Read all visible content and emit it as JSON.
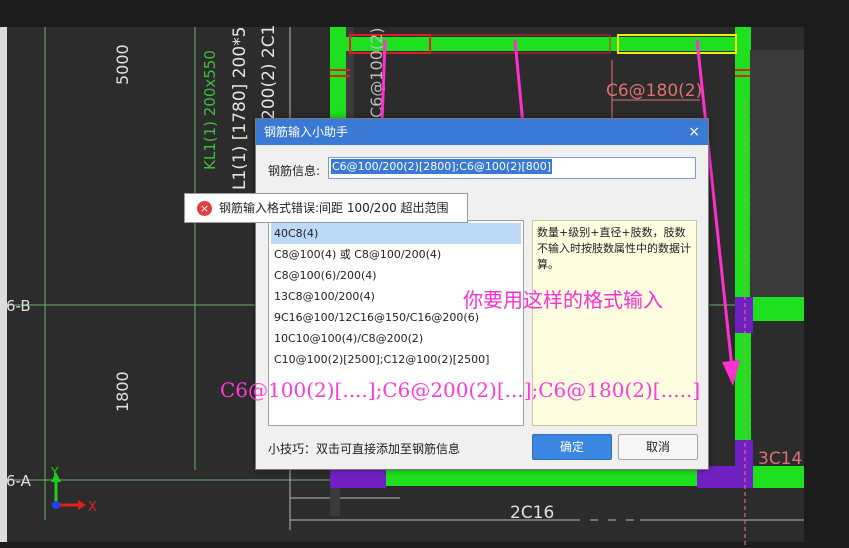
{
  "cad": {
    "dim_5000": "5000",
    "dim_1800": "1800",
    "axis_6b": "6-B",
    "axis_6a": "6-A",
    "beam_label_1": "KL1(1) 200x550",
    "beam_label_2": "L1(1) [1780] 200*5",
    "beam_label_3": "200(2) 2C1",
    "rebar_c6_180": "C6@180(2)",
    "rebar_3c14": "3C14",
    "rebar_2c16": "2C16",
    "rebar_c6_100": "C6@100(2)",
    "axis_x": "X",
    "axis_y": "Y"
  },
  "dialog": {
    "title": "钢筋输入小助手",
    "close_label": "×",
    "info_label": "钢筋信息:",
    "info_value": "C6@100/200(2)[2800];C6@100(2)[800]",
    "examples": [
      "40C8(4)",
      "C8@100(4) 或 C8@100/200(4)",
      "C8@100(6)/200(4)",
      "13C8@100/200(4)",
      "9C16@100/12C16@150/C16@200(6)",
      "10C10@100(4)/C8@200(2)",
      "C10@100(2)[2500];C12@100(2)[2500]"
    ],
    "description": "数量+级别+直径+肢数，肢数不输入时按肢数属性中的数据计算。",
    "tip": "小技巧：双击可直接添加至钢筋信息",
    "ok_label": "确定",
    "cancel_label": "取消"
  },
  "error_tooltip": {
    "icon": "×",
    "message": "钢筋输入格式错误:间距 100/200 超出范围"
  },
  "annotation": {
    "hint": "你要用这样的格式输入",
    "format": "C6@100(2)[....];C6@200(2)[...];C6@180(2)[.....]",
    "color": "#ff2fd0"
  }
}
